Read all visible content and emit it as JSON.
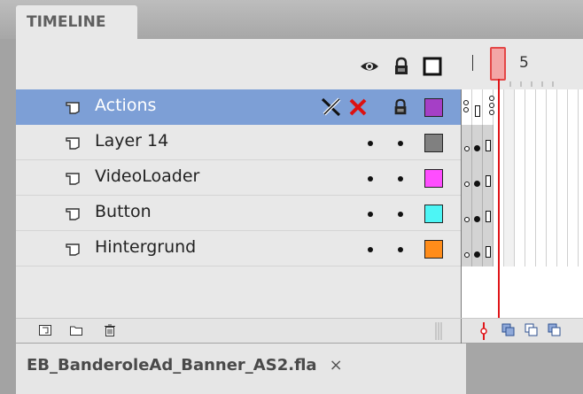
{
  "panel": {
    "tab_label": "TIMELINE",
    "header_icons": [
      "eye-icon",
      "lock-icon",
      "outline-square-icon"
    ]
  },
  "ruler": {
    "frame_number": "5"
  },
  "layers": [
    {
      "name": "Actions",
      "color": "#a53fc6",
      "selected": true,
      "eye": "x-mark",
      "lock": "lock"
    },
    {
      "name": "Layer 14",
      "color": "#808080",
      "selected": false,
      "eye": "dot",
      "lock": "dot"
    },
    {
      "name": "VideoLoader",
      "color": "#ff4dff",
      "selected": false,
      "eye": "dot",
      "lock": "dot"
    },
    {
      "name": "Button",
      "color": "#4df5f5",
      "selected": false,
      "eye": "dot",
      "lock": "dot"
    },
    {
      "name": "Hintergrund",
      "color": "#ff8c1a",
      "selected": false,
      "eye": "dot",
      "lock": "dot"
    }
  ],
  "bottom_icons": [
    "new-layer-icon",
    "new-folder-icon",
    "delete-layer-icon"
  ],
  "document": {
    "filename": "EB_BanderoleAd_Banner_AS2.fla",
    "close_label": "×"
  },
  "colors": {
    "selection": "#7d9fd6",
    "playhead": "#e0161a",
    "panel_bg": "#e8e8e8"
  }
}
